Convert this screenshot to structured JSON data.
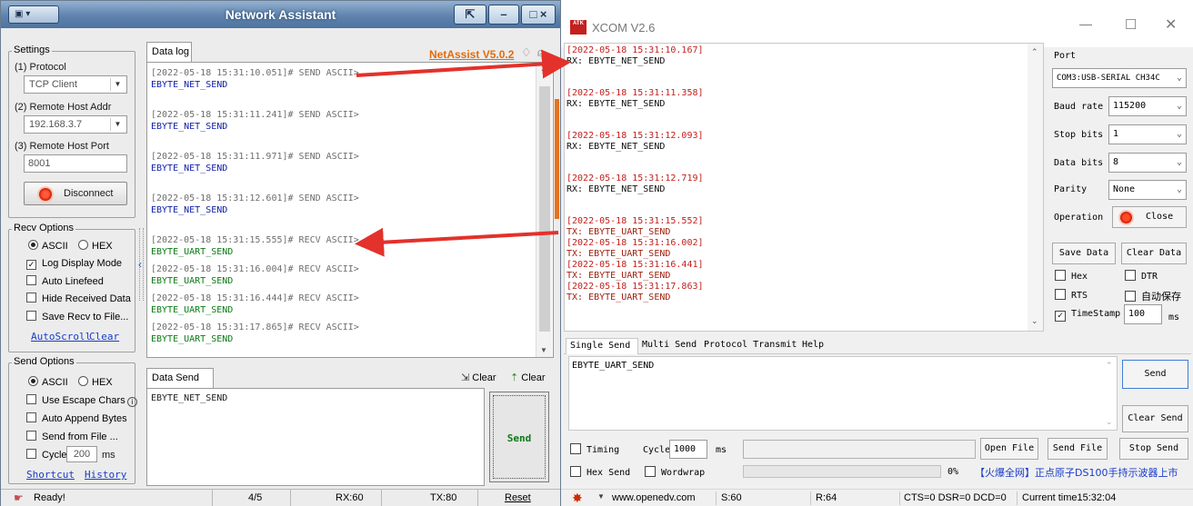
{
  "na": {
    "title": "Network Assistant",
    "settings": {
      "label": "Settings",
      "protocol_label": "(1) Protocol",
      "protocol_value": "TCP Client",
      "host_addr_label": "(2) Remote Host Addr",
      "host_addr_value": "192.168.3.7",
      "host_port_label": "(3) Remote Host Port",
      "host_port_value": "8001",
      "disconnect_label": "Disconnect"
    },
    "recv_options": {
      "label": "Recv Options",
      "ascii": "ASCII",
      "hex": "HEX",
      "log_display_mode": "Log Display Mode",
      "auto_linefeed": "Auto Linefeed",
      "hide_received_data": "Hide Received Data",
      "save_recv_to_file": "Save Recv to File...",
      "autoscroll": "AutoScroll",
      "clear": "Clear"
    },
    "send_options": {
      "label": "Send Options",
      "ascii": "ASCII",
      "hex": "HEX",
      "use_escape_chars": "Use Escape Chars",
      "auto_append_bytes": "Auto Append Bytes",
      "send_from_file": "Send from File ...",
      "cycle_label": "Cycle",
      "cycle_value": "200",
      "cycle_unit": "ms",
      "shortcut": "Shortcut",
      "history": "History"
    },
    "data_log": {
      "tab": "Data log",
      "brand": "NetAssist V5.0.2",
      "entries": [
        {
          "header": "[2022-05-18 15:31:10.051]# SEND ASCII>",
          "body": "EBYTE_NET_SEND"
        },
        {
          "header": "[2022-05-18 15:31:11.241]# SEND ASCII>",
          "body": "EBYTE_NET_SEND"
        },
        {
          "header": "[2022-05-18 15:31:11.971]# SEND ASCII>",
          "body": "EBYTE_NET_SEND"
        },
        {
          "header": "[2022-05-18 15:31:12.601]# SEND ASCII>",
          "body": "EBYTE_NET_SEND"
        },
        {
          "header": "[2022-05-18 15:31:15.555]# RECV ASCII>",
          "body": "EBYTE_UART_SEND"
        },
        {
          "header": "[2022-05-18 15:31:16.004]# RECV ASCII>",
          "body": "EBYTE_UART_SEND"
        },
        {
          "header": "[2022-05-18 15:31:16.444]# RECV ASCII>",
          "body": "EBYTE_UART_SEND"
        },
        {
          "header": "[2022-05-18 15:31:17.865]# RECV ASCII>",
          "body": "EBYTE_UART_SEND"
        }
      ]
    },
    "data_send": {
      "tab": "Data Send",
      "clear1": "Clear",
      "clear2": "Clear",
      "text": "EBYTE_NET_SEND",
      "send": "Send"
    },
    "status": {
      "ready": "Ready!",
      "count": "4/5",
      "rx": "RX:60",
      "tx": "TX:80",
      "reset": "Reset"
    }
  },
  "xcom": {
    "title": "XCOM V2.6",
    "logo_text": "ATK",
    "log": [
      {
        "ts": "[2022-05-18 15:31:10.167]",
        "msg": "RX: EBYTE_NET_SEND"
      },
      {
        "ts": "[2022-05-18 15:31:11.358]",
        "msg": "RX: EBYTE_NET_SEND"
      },
      {
        "ts": "[2022-05-18 15:31:12.093]",
        "msg": "RX: EBYTE_NET_SEND"
      },
      {
        "ts": "[2022-05-18 15:31:12.719]",
        "msg": "RX: EBYTE_NET_SEND"
      },
      {
        "ts": "[2022-05-18 15:31:15.552]",
        "msg": "TX: EBYTE_UART_SEND"
      },
      {
        "ts": "[2022-05-18 15:31:16.002]",
        "msg": "TX: EBYTE_UART_SEND"
      },
      {
        "ts": "[2022-05-18 15:31:16.441]",
        "msg": "TX: EBYTE_UART_SEND"
      },
      {
        "ts": "[2022-05-18 15:31:17.863]",
        "msg": "TX: EBYTE_UART_SEND"
      }
    ],
    "port_label": "Port",
    "port_value": "COM3:USB-SERIAL CH34C",
    "baud_label": "Baud rate",
    "baud_value": "115200",
    "stop_label": "Stop bits",
    "stop_value": "1",
    "data_label": "Data bits",
    "data_value": "8",
    "parity_label": "Parity",
    "parity_value": "None",
    "operation_label": "Operation",
    "close_label": "Close",
    "save_data": "Save Data",
    "clear_data": "Clear Data",
    "hex": "Hex",
    "dtr": "DTR",
    "rts": "RTS",
    "autosave": "自动保存",
    "timestamp": "TimeStamp",
    "timestamp_value": "100",
    "timestamp_unit": "ms",
    "tabs": [
      "Single Send",
      "Multi Send",
      "Protocol Transmit",
      "Help"
    ],
    "send_text": "EBYTE_UART_SEND",
    "send_btn": "Send",
    "clear_send": "Clear Send",
    "timing": "Timing",
    "cycle_label": "Cycle",
    "cycle_value": "1000",
    "cycle_unit": "ms",
    "open_file": "Open File",
    "send_file": "Send File",
    "stop_send": "Stop Send",
    "hex_send": "Hex Send",
    "wordwrap": "Wordwrap",
    "progress": "0%",
    "ad": "【火爆全网】正点原子DS100手持示波器上市",
    "status": {
      "url": "www.openedv.com",
      "s": "S:60",
      "r": "R:64",
      "lines": "CTS=0 DSR=0 DCD=0",
      "time": "Current time15:32:04"
    },
    "accent_red": "#c3201e"
  }
}
